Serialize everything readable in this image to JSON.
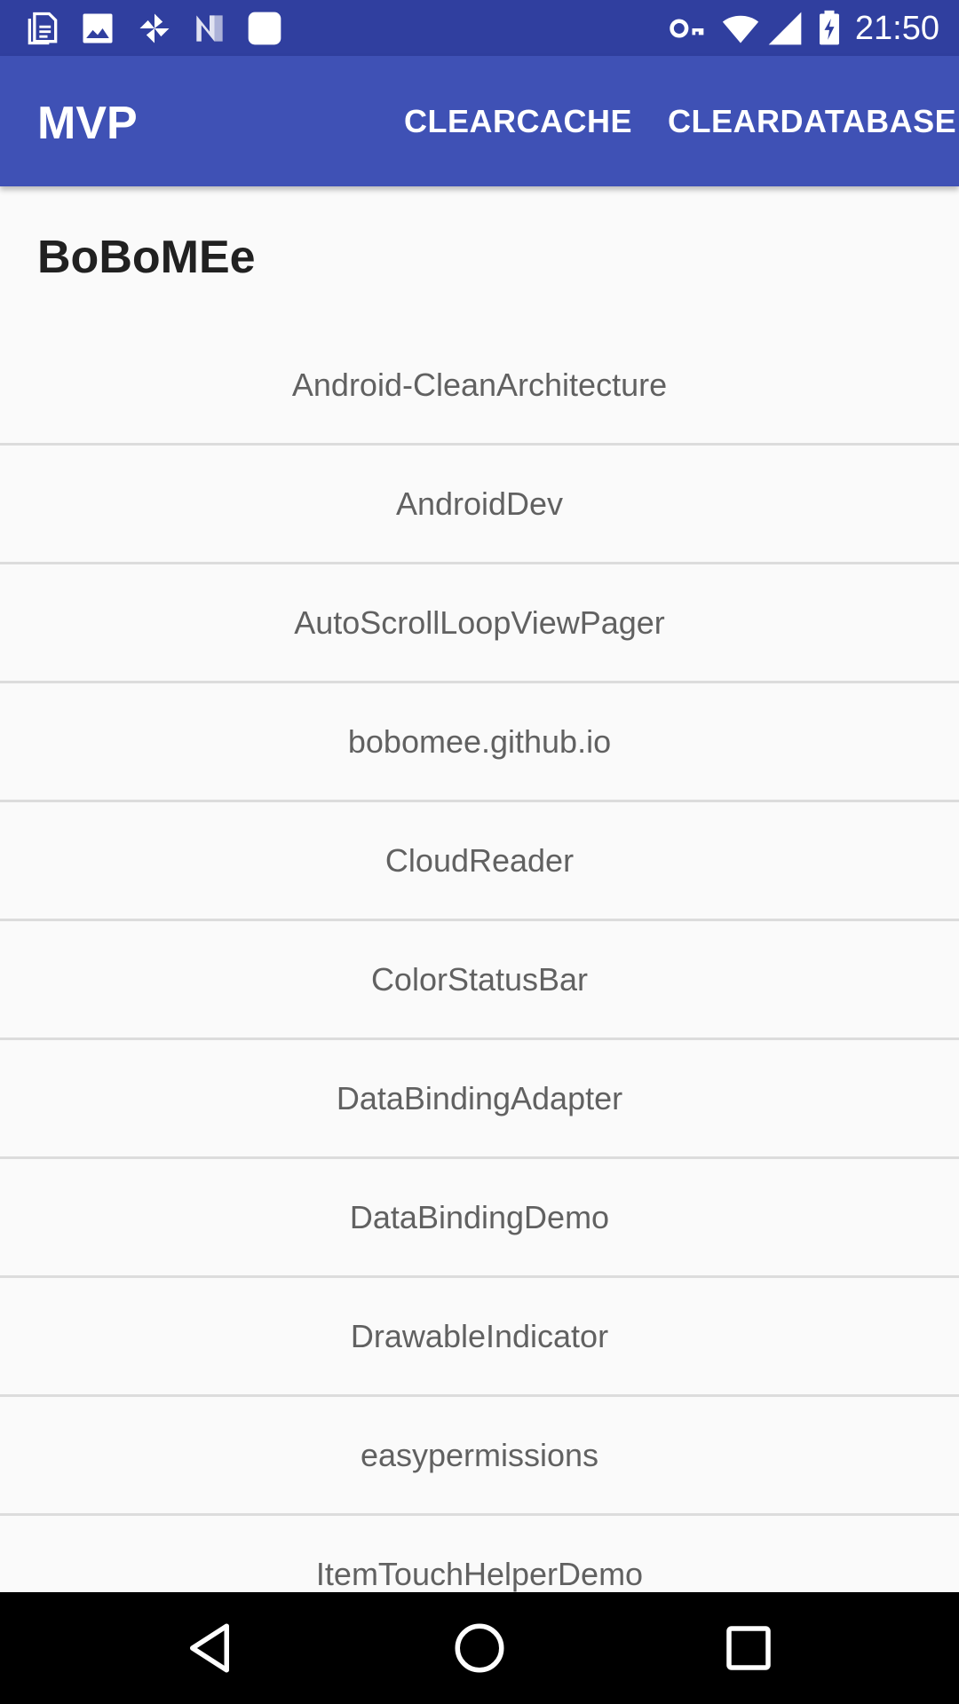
{
  "status_bar": {
    "time": "21:50",
    "left_icons": [
      "notes-icon",
      "image-icon",
      "pinwheel-icon",
      "n-logo-icon",
      "white-square-icon"
    ],
    "right_icons": [
      "vpn-key-icon",
      "wifi-icon",
      "cell-signal-icon",
      "battery-charging-icon"
    ],
    "color": "#303f9f"
  },
  "toolbar": {
    "title": "MVP",
    "actions": [
      "CLEARCACHE",
      "CLEARDATABASE"
    ],
    "color": "#3f51b5"
  },
  "profile": {
    "name": "BoBoMEe"
  },
  "repos": [
    "Android-CleanArchitecture",
    "AndroidDev",
    "AutoScrollLoopViewPager",
    "bobomee.github.io",
    "CloudReader",
    "ColorStatusBar",
    "DataBindingAdapter",
    "DataBindingDemo",
    "DrawableIndicator",
    "easypermissions",
    "ItemTouchHelperDemo"
  ],
  "nav_bar": {
    "buttons": [
      "back-icon",
      "home-icon",
      "recents-icon"
    ]
  }
}
